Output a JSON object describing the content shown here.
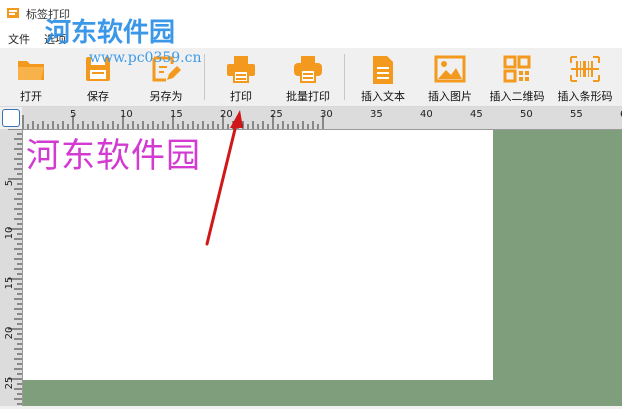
{
  "window": {
    "title": "标签打印"
  },
  "menu": {
    "items": [
      "文件",
      "选项"
    ]
  },
  "toolbar": {
    "buttons": [
      {
        "id": "open",
        "label": "打开",
        "icon": "folder-icon"
      },
      {
        "id": "save",
        "label": "保存",
        "icon": "save-icon"
      },
      {
        "id": "save_as",
        "label": "另存为",
        "icon": "save-as-icon"
      },
      {
        "id": "print",
        "label": "打印",
        "icon": "printer-icon"
      },
      {
        "id": "batch_print",
        "label": "批量打印",
        "icon": "batch-printer-icon"
      },
      {
        "id": "insert_text",
        "label": "插入文本",
        "icon": "document-icon"
      },
      {
        "id": "insert_image",
        "label": "插入图片",
        "icon": "image-icon"
      },
      {
        "id": "insert_qrcode",
        "label": "插入二维码",
        "icon": "qrcode-icon"
      },
      {
        "id": "insert_barcode",
        "label": "插入条形码",
        "icon": "barcode-icon"
      }
    ]
  },
  "ruler": {
    "horizontal_labels": [
      "5",
      "10",
      "15",
      "20",
      "25",
      "30",
      "35",
      "40",
      "45",
      "50",
      "55",
      "6"
    ],
    "vertical_labels": [
      "5",
      "10",
      "15",
      "20",
      "25"
    ]
  },
  "canvas": {
    "label_text": "河东软件园"
  },
  "watermark": {
    "logo_text": "河东软件园",
    "url_text": "www.pc0359.cn"
  },
  "colors": {
    "accent": "#f39a1e",
    "label_text": "#d23ad2",
    "workarea": "#7f9e7c",
    "arrow": "#d01818",
    "watermark": "#2b8fe6"
  }
}
